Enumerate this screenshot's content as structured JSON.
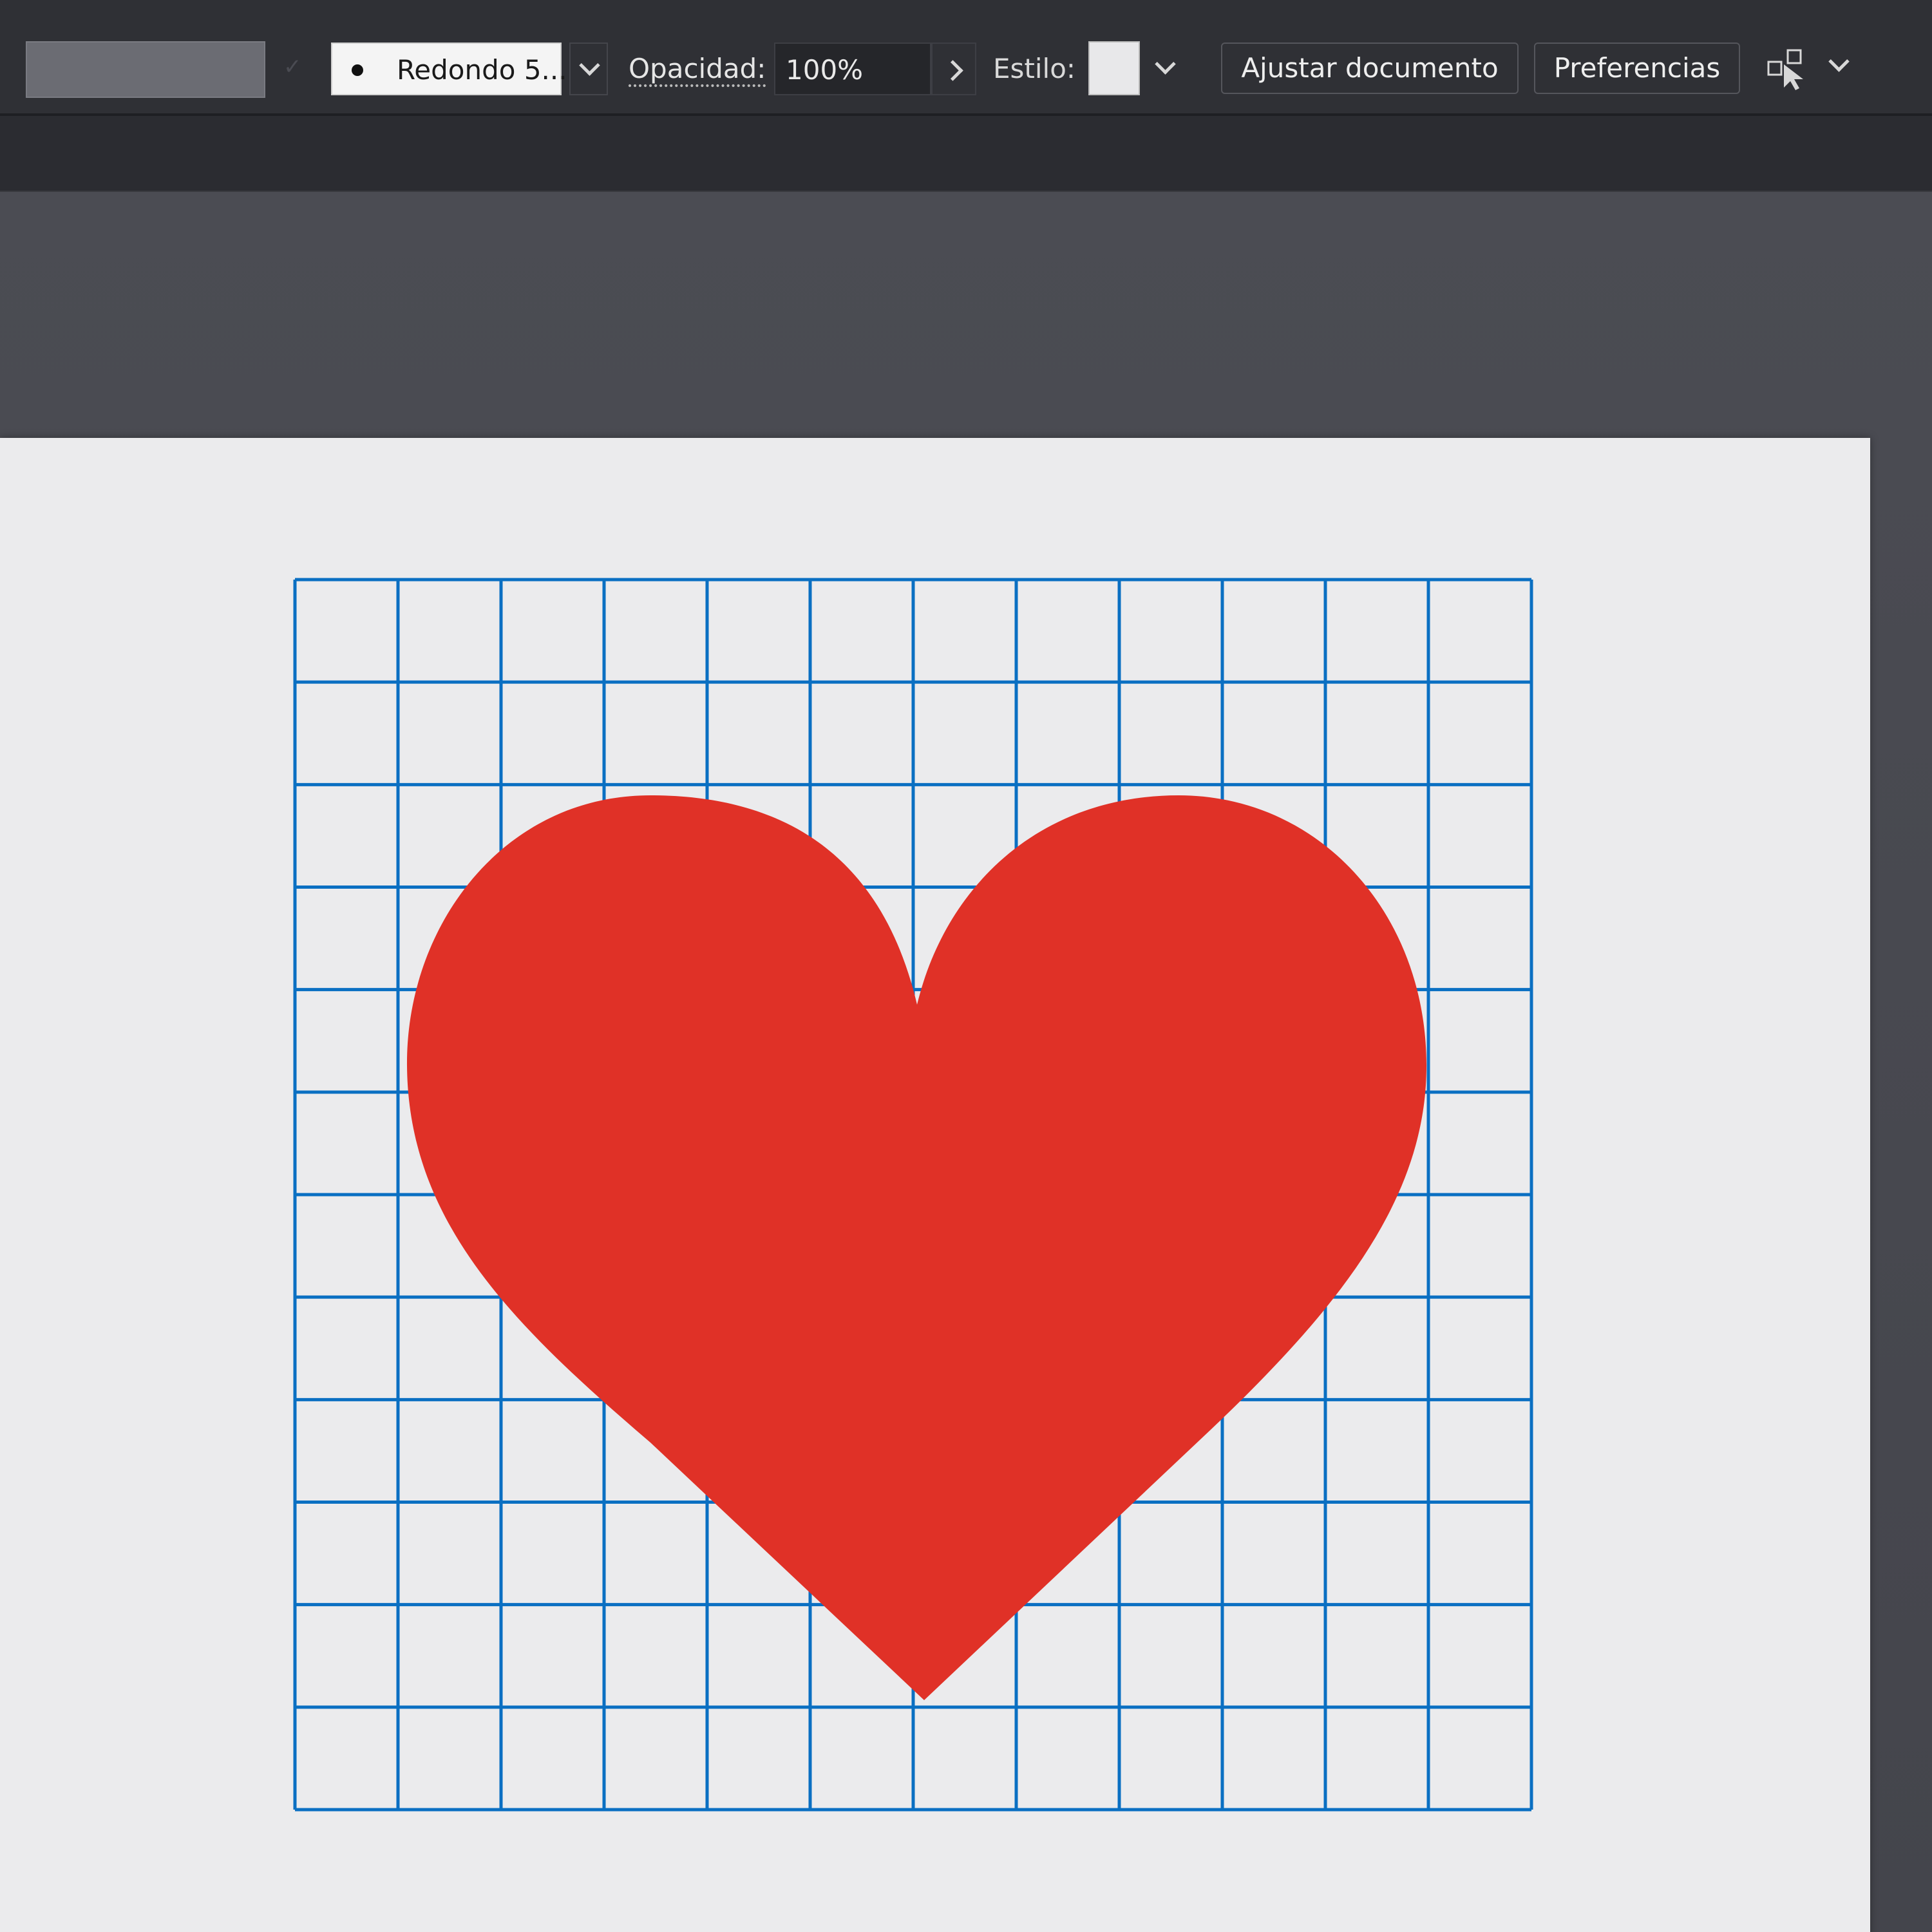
{
  "toolbar": {
    "stroke_check_glyph": "✓",
    "brush": {
      "label": "Redondo 5..."
    },
    "opacity": {
      "label": "Opacidad:",
      "value": "100%"
    },
    "style": {
      "label": "Estilo:"
    },
    "document_setup_label": "Ajustar documento",
    "preferences_label": "Preferencias"
  },
  "icons": {
    "stroke_check": "check-icon",
    "brush_dot": "brush-dot-icon",
    "brush_dropdown": "chevron-down-icon",
    "opacity_arrow": "chevron-right-icon",
    "style_dropdown": "chevron-down-icon",
    "arrange": "arrange-documents-icon",
    "arrange_dropdown": "chevron-down-icon"
  },
  "artwork": {
    "grid": {
      "columns": 12,
      "rows": 12
    },
    "heart": {
      "shape": "heart"
    }
  },
  "colors": {
    "control_bar": "#2f3035",
    "tab_strip": "#2b2c31",
    "pasteboard": "#46474e",
    "artboard": "#ebebed",
    "grid_line": "#0a6fc2",
    "heart_fill": "#e03127"
  }
}
